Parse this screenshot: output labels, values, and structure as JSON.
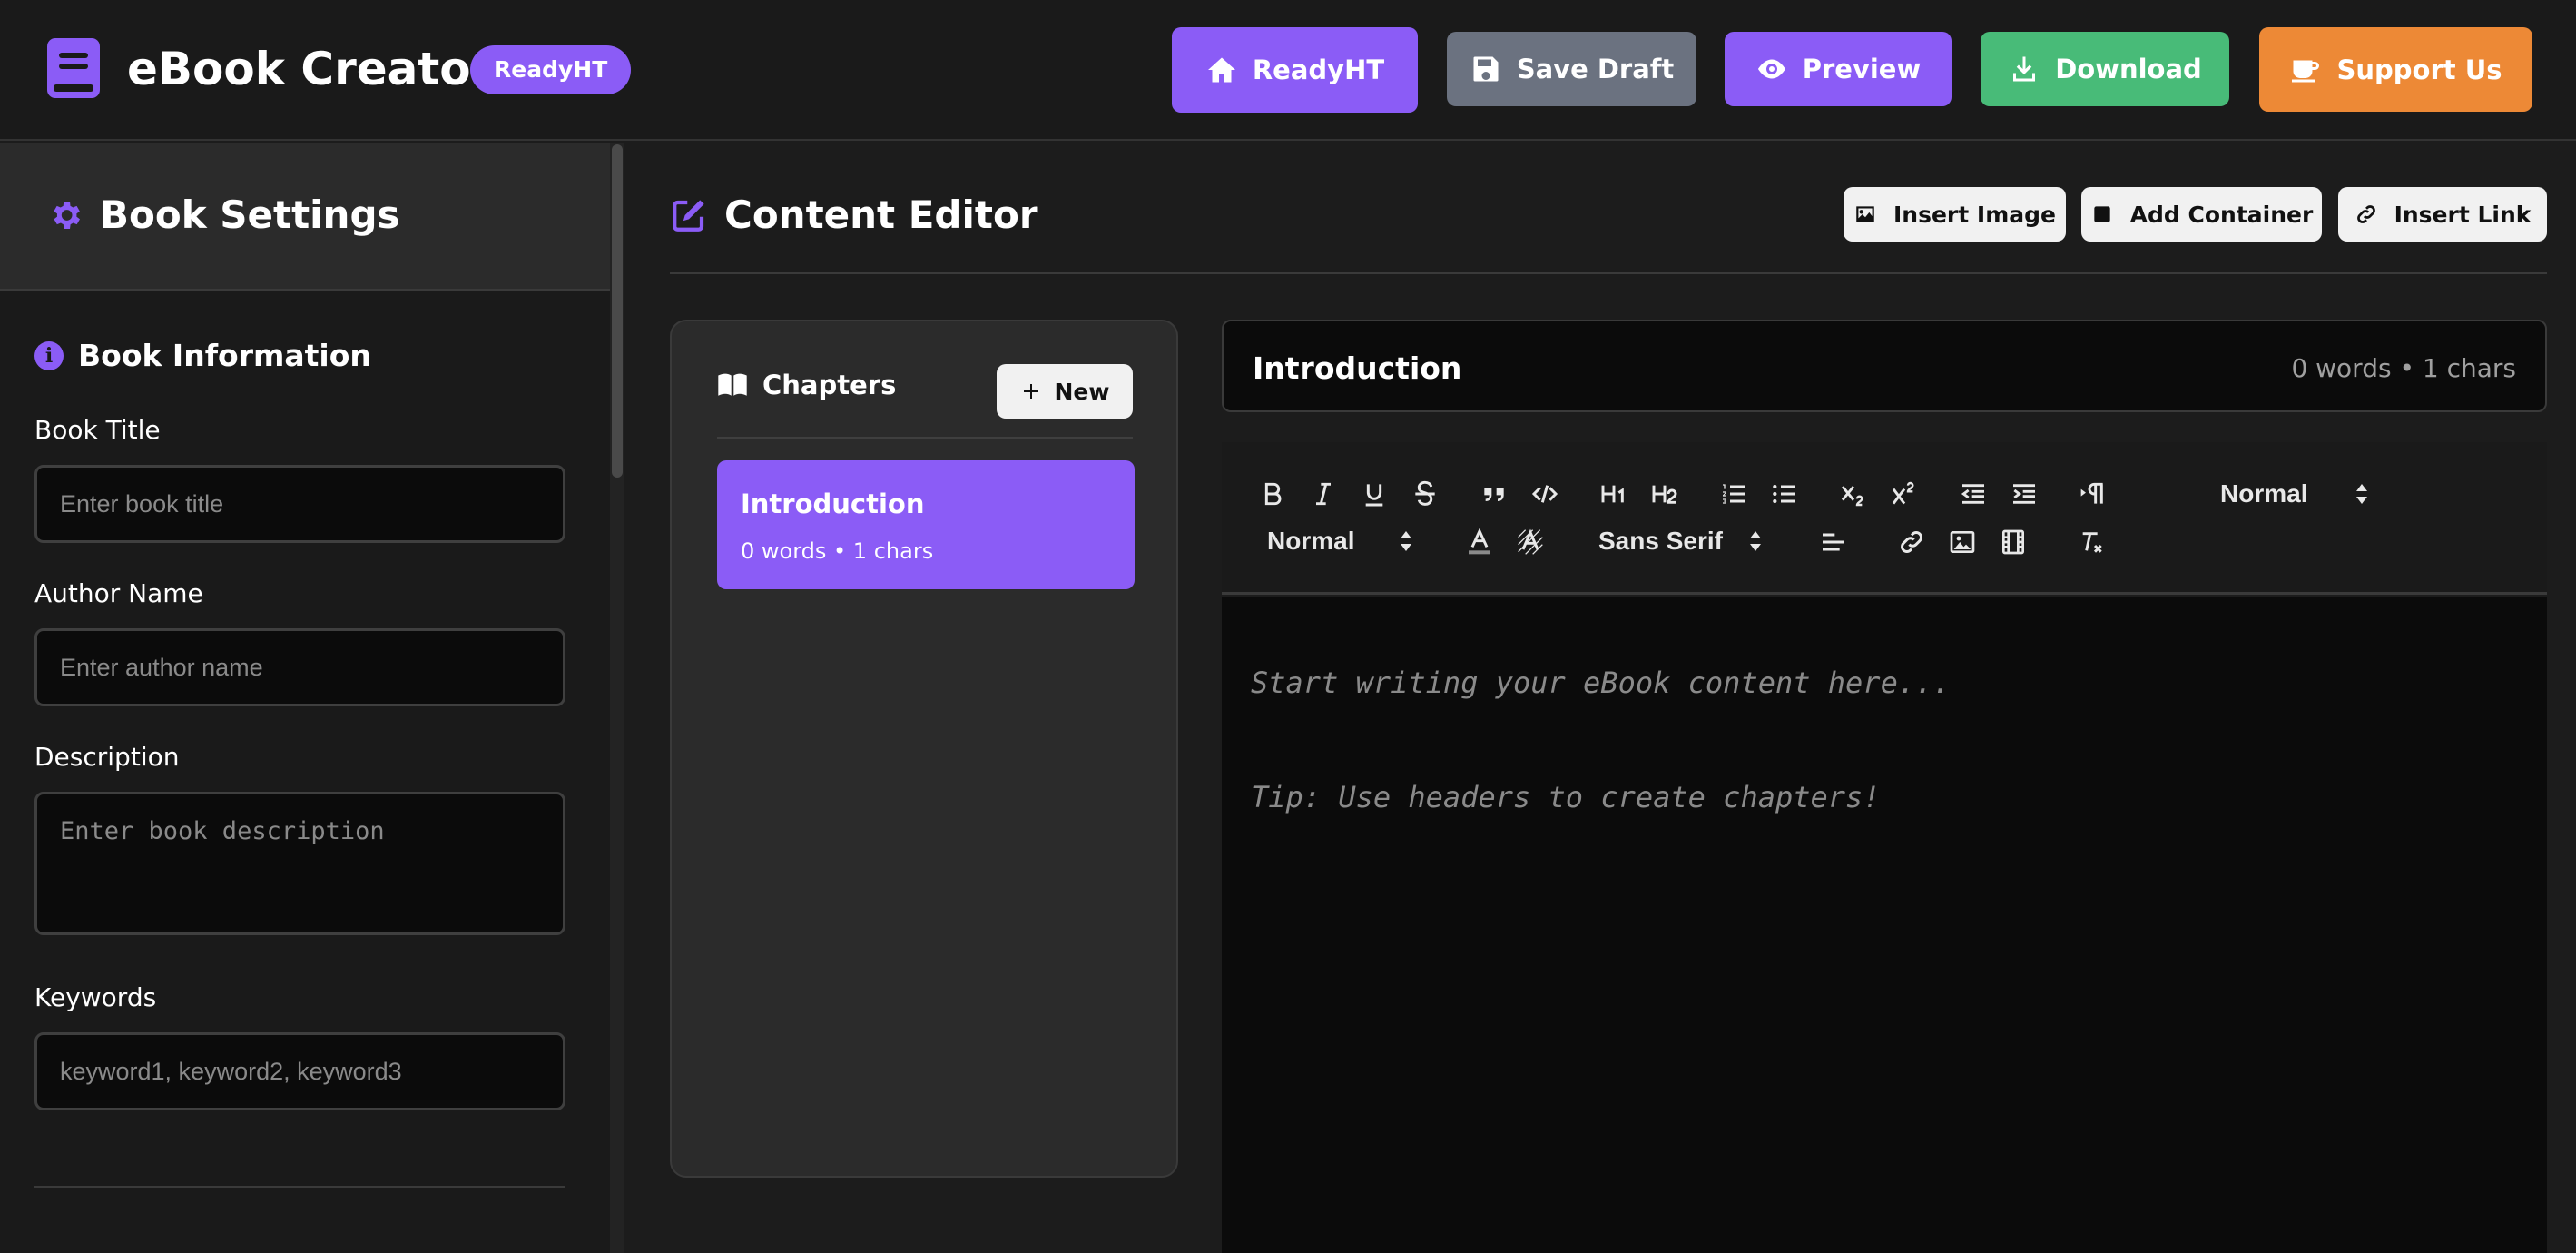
{
  "header": {
    "app_title": "eBook Creator",
    "badge": "ReadyHT",
    "buttons": {
      "readyht": "ReadyHT",
      "save_draft": "Save Draft",
      "preview": "Preview",
      "download": "Download",
      "support": "Support Us"
    },
    "colors": {
      "readyht": "#8b5cf6",
      "save_draft": "#6b7280",
      "preview": "#8b5cf6",
      "download": "#48bb78",
      "support": "#ed8936"
    }
  },
  "sidebar": {
    "title": "Book Settings",
    "section_title": "Book Information",
    "fields": {
      "title_label": "Book Title",
      "title_placeholder": "Enter book title",
      "author_label": "Author Name",
      "author_placeholder": "Enter author name",
      "description_label": "Description",
      "description_placeholder": "Enter book description",
      "keywords_label": "Keywords",
      "keywords_placeholder": "keyword1, keyword2, keyword3"
    }
  },
  "editor": {
    "title": "Content Editor",
    "actions": {
      "insert_image": "Insert Image",
      "add_container": "Add Container",
      "insert_link": "Insert Link"
    },
    "chapters": {
      "heading": "Chapters",
      "new_button": "New",
      "items": [
        {
          "title": "Introduction",
          "stats": "0 words • 1 chars"
        }
      ]
    },
    "current_chapter": {
      "title": "Introduction",
      "stats": "0 words • 1 chars"
    },
    "toolbar": {
      "header_select": "Normal",
      "size_select": "Normal",
      "font_select": "Sans Serif"
    },
    "placeholder_line1": "Start writing your eBook content here...",
    "placeholder_line2": "Tip: Use headers to create chapters!"
  },
  "accent_color": "#8b5cf6"
}
